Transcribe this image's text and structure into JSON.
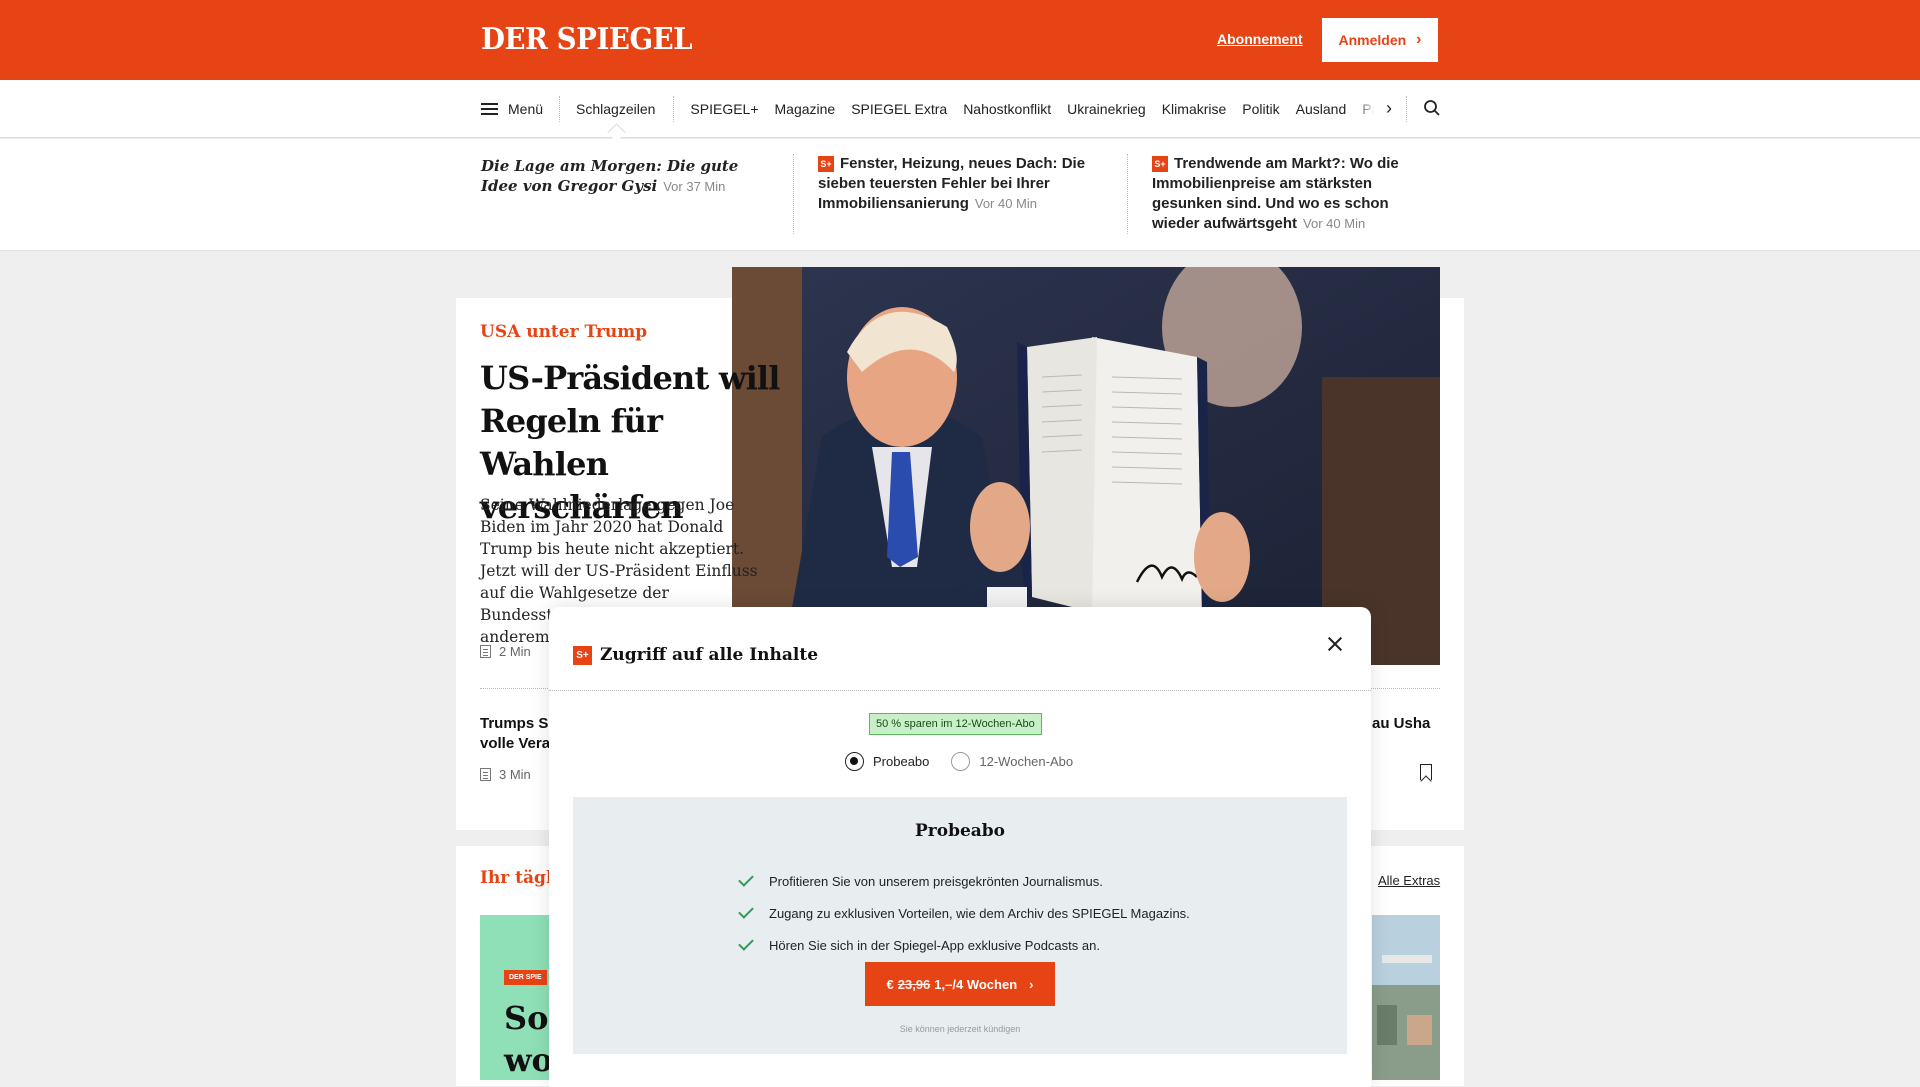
{
  "header": {
    "logo": "DER SPIEGEL",
    "subscription_link": "Abonnement",
    "login_button": "Anmelden",
    "brand_color": "#e64415"
  },
  "nav": {
    "menu_label": "Menü",
    "items": [
      "Schlagzeilen",
      "SPIEGEL+",
      "Magazine",
      "SPIEGEL Extra",
      "Nahostkonflikt",
      "Ukrainekrieg",
      "Klimakrise",
      "Politik",
      "Ausland"
    ],
    "cut_item": "Panor",
    "next_icon": "chevron-right-icon",
    "search_icon": "search-icon"
  },
  "ticker": [
    {
      "title": "Die Lage am Morgen: Die gute Idee von Gregor Gysi",
      "time": "Vor 37 Min",
      "plus": false
    },
    {
      "title": "Fenster, Heizung, neues Dach: Die sieben teuersten Fehler bei Ihrer Immobiliensanierung",
      "time": "Vor 40 Min",
      "plus": true
    },
    {
      "title": "Trendwende am Markt?: Wo die Immobilienpreise am stärksten gesunken sind. Und wo es schon wieder aufwärtsgeht",
      "time": "Vor 40 Min",
      "plus": true
    }
  ],
  "lead": {
    "kicker": "USA unter Trump",
    "headline": "US-Präsident will Regeln für Wahlen verschärfen",
    "teaser": "Seine Wahlniederlage gegen Joe Biden im Jahr 2020 hat Donald Trump bis heute nicht akzeptiert. Jetzt will der US-Präsident Einfluss auf die Wahlgesetze der Bundesstaaten nehmen – und unter anderem d",
    "readtime": "2 Min"
  },
  "secondary": {
    "left_title": "Trumps S\nvolle Vera",
    "left_readtime": "3 Min",
    "right_title": "au Usha"
  },
  "daily": {
    "title": "Ihr täglic",
    "all_extras": "Alle Extras",
    "promo_badge": "DER SPIE",
    "promo_text": "So\nwo"
  },
  "modal": {
    "plus_badge": "S+",
    "title": "Zugriff auf alle Inhalte",
    "save_badge": "50 % sparen im 12-Wochen-Abo",
    "options": [
      {
        "label": "Probeabo",
        "selected": true
      },
      {
        "label": "12-Wochen-Abo",
        "selected": false
      }
    ],
    "plan_title": "Probeabo",
    "benefits": [
      "Profitieren Sie von unserem preisgekrönten Journalismus.",
      "Zugang zu exklusiven Vorteilen, wie dem Archiv des SPIEGEL Magazins.",
      "Hören Sie sich in der Spiegel-App exklusive Podcasts an."
    ],
    "cta_currency": "€",
    "cta_old_price": "23,96",
    "cta_price": "1,–/4 Wochen",
    "cancel_note": "Sie können jederzeit kündigen"
  }
}
